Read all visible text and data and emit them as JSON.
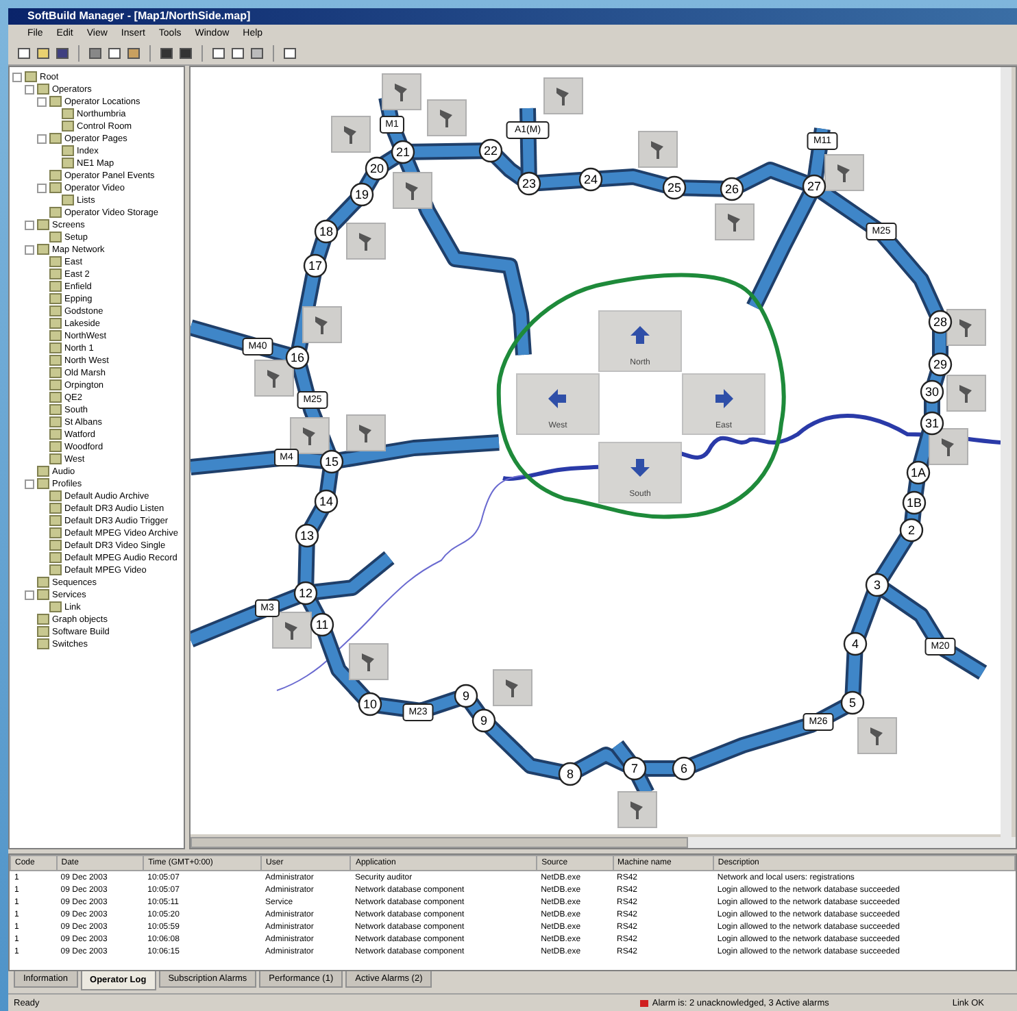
{
  "window": {
    "title": "SoftBuild Manager - [Map1/NorthSide.map]"
  },
  "menu": [
    "File",
    "Edit",
    "View",
    "Insert",
    "Tools",
    "Window",
    "Help"
  ],
  "tree": [
    {
      "label": "Root",
      "children": [
        {
          "label": "Operators",
          "children": [
            {
              "label": "Operator Locations",
              "children": [
                {
                  "label": "Northumbria"
                },
                {
                  "label": "Control Room"
                }
              ]
            },
            {
              "label": "Operator Pages",
              "children": [
                {
                  "label": "Index"
                },
                {
                  "label": "NE1 Map"
                }
              ]
            },
            {
              "label": "Operator Panel Events"
            },
            {
              "label": "Operator Video",
              "children": [
                {
                  "label": "Lists"
                }
              ]
            },
            {
              "label": "Operator Video Storage"
            }
          ]
        },
        {
          "label": "Screens",
          "children": [
            {
              "label": "Setup"
            }
          ]
        },
        {
          "label": "Map Network",
          "children": [
            {
              "label": "East"
            },
            {
              "label": "East 2"
            },
            {
              "label": "Enfield"
            },
            {
              "label": "Epping"
            },
            {
              "label": "Godstone"
            },
            {
              "label": "Lakeside"
            },
            {
              "label": "NorthWest"
            },
            {
              "label": "North 1"
            },
            {
              "label": "North West"
            },
            {
              "label": "Old Marsh"
            },
            {
              "label": "Orpington"
            },
            {
              "label": "QE2"
            },
            {
              "label": "South"
            },
            {
              "label": "St Albans"
            },
            {
              "label": "Watford"
            },
            {
              "label": "Woodford"
            },
            {
              "label": "West"
            }
          ]
        },
        {
          "label": "Audio"
        },
        {
          "label": "Profiles",
          "children": [
            {
              "label": "Default Audio Archive"
            },
            {
              "label": "Default DR3 Audio Listen"
            },
            {
              "label": "Default DR3 Audio Trigger"
            },
            {
              "label": "Default MPEG Video Archive"
            },
            {
              "label": "Default DR3 Video Single"
            },
            {
              "label": "Default MPEG Audio Record"
            },
            {
              "label": "Default MPEG Video"
            }
          ]
        },
        {
          "label": "Sequences"
        },
        {
          "label": "Services",
          "children": [
            {
              "label": "Link"
            }
          ]
        },
        {
          "label": "Graph objects"
        },
        {
          "label": "Software Build"
        },
        {
          "label": "Switches"
        }
      ]
    }
  ],
  "map": {
    "junctions": [
      "20",
      "21",
      "22",
      "19",
      "23",
      "24",
      "25",
      "26",
      "27",
      "18",
      "17",
      "28",
      "16",
      "29",
      "30",
      "31",
      "15",
      "1A",
      "14",
      "1B",
      "13",
      "2",
      "12",
      "3",
      "11",
      "4",
      "10",
      "9",
      "9",
      "5",
      "8",
      "7",
      "6"
    ],
    "road_labels": [
      "M1",
      "A1(M)",
      "M11",
      "M25",
      "M40",
      "M25",
      "M4",
      "M3",
      "M23",
      "M26",
      "M20"
    ],
    "pan_buttons": [
      "North",
      "West",
      "East",
      "South"
    ]
  },
  "log": {
    "columns": [
      "Code",
      "Date",
      "Time (GMT+0:00)",
      "User",
      "Application",
      "Source",
      "Machine name",
      "Description"
    ],
    "rows": [
      [
        "1",
        "09 Dec 2003",
        "10:05:07",
        "Administrator",
        "Security auditor",
        "NetDB.exe",
        "RS42",
        "Network and local users: registrations"
      ],
      [
        "1",
        "09 Dec 2003",
        "10:05:07",
        "Administrator",
        "Network database component",
        "NetDB.exe",
        "RS42",
        "Login allowed to the network database succeeded"
      ],
      [
        "1",
        "09 Dec 2003",
        "10:05:11",
        "Service",
        "Network database component",
        "NetDB.exe",
        "RS42",
        "Login allowed to the network database succeeded"
      ],
      [
        "1",
        "09 Dec 2003",
        "10:05:20",
        "Administrator",
        "Network database component",
        "NetDB.exe",
        "RS42",
        "Login allowed to the network database succeeded"
      ],
      [
        "1",
        "09 Dec 2003",
        "10:05:59",
        "Administrator",
        "Network database component",
        "NetDB.exe",
        "RS42",
        "Login allowed to the network database succeeded"
      ],
      [
        "1",
        "09 Dec 2003",
        "10:06:08",
        "Administrator",
        "Network database component",
        "NetDB.exe",
        "RS42",
        "Login allowed to the network database succeeded"
      ],
      [
        "1",
        "09 Dec 2003",
        "10:06:15",
        "Administrator",
        "Network database component",
        "NetDB.exe",
        "RS42",
        "Login allowed to the network database succeeded"
      ]
    ]
  },
  "tabs": [
    {
      "label": "Information",
      "selected": false
    },
    {
      "label": "Operator Log",
      "selected": true
    },
    {
      "label": "Subscription Alarms",
      "selected": false
    },
    {
      "label": "Performance (1)",
      "selected": false
    },
    {
      "label": "Active Alarms (2)",
      "selected": false
    }
  ],
  "status_bar": {
    "left": "Ready",
    "alarm": "Alarm is: 2 unacknowledged, 3 Active alarms",
    "right": "Link OK"
  }
}
